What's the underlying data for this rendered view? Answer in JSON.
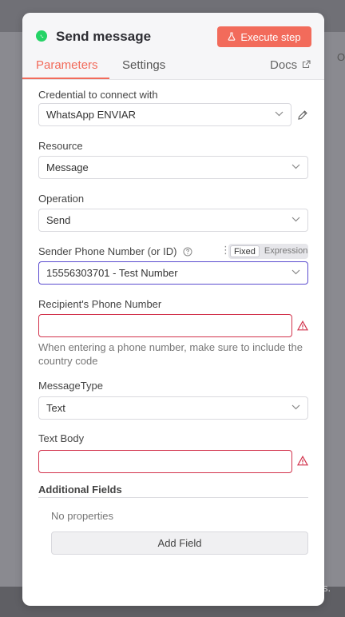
{
  "panel": {
    "title": "Send message",
    "execute_label": "Execute step",
    "tabs": [
      {
        "label": "Parameters"
      },
      {
        "label": "Settings"
      }
    ],
    "docs_label": "Docs"
  },
  "form": {
    "credential": {
      "label": "Credential to connect with",
      "value": "WhatsApp ENVIAR"
    },
    "resource": {
      "label": "Resource",
      "value": "Message"
    },
    "operation": {
      "label": "Operation",
      "value": "Send"
    },
    "sender": {
      "label": "Sender Phone Number (or ID)",
      "value": "15556303701 - Test Number",
      "mode_fixed": "Fixed",
      "mode_expression": "Expression"
    },
    "recipient": {
      "label": "Recipient's Phone Number",
      "value": "",
      "hint": "When entering a phone number, make sure to include the country code"
    },
    "message_type": {
      "label": "MessageType",
      "value": "Text"
    },
    "text_body": {
      "label": "Text Body",
      "value": ""
    },
    "additional": {
      "title": "Additional Fields",
      "empty_text": "No properties",
      "add_label": "Add Field"
    }
  },
  "background": {
    "right_text_top": "O",
    "right_text_bottom": "s."
  },
  "colors": {
    "accent": "#f26b5b",
    "error": "#d2334c",
    "focus": "#5b4ccf",
    "whatsapp": "#25d366"
  }
}
